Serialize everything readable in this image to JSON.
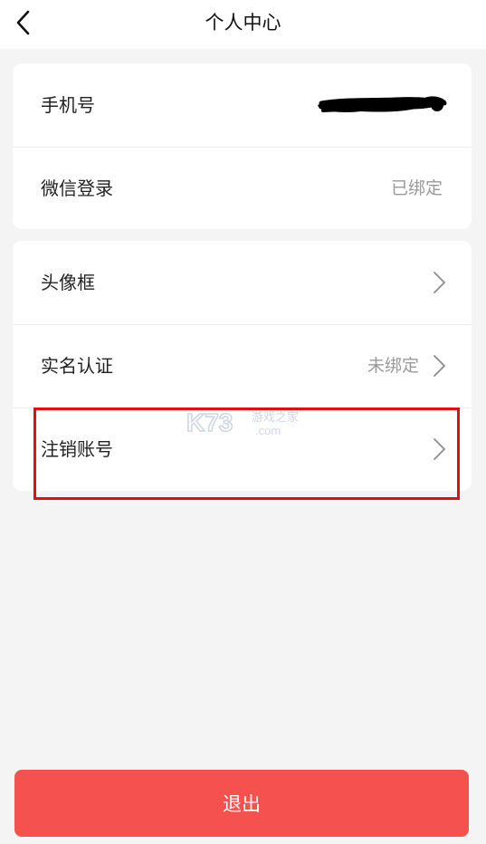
{
  "header": {
    "title": "个人中心",
    "back_icon": "chevron-left-icon"
  },
  "account_card": {
    "phone": {
      "label": "手机号",
      "value_redacted": true
    },
    "wechat": {
      "label": "微信登录",
      "value": "已绑定"
    }
  },
  "settings_card": {
    "avatar_frame": {
      "label": "头像框",
      "icon": "chevron-right-icon"
    },
    "real_name": {
      "label": "实名认证",
      "value": "未绑定",
      "icon": "chevron-right-icon"
    },
    "cancel_account": {
      "label": "注销账号",
      "icon": "chevron-right-icon"
    }
  },
  "watermark": {
    "brand": "K73",
    "tagline": "游戏之家",
    "domain": ".com"
  },
  "annotation": {
    "highlight_color": "#e01010"
  },
  "logout": {
    "label": "退出",
    "color": "#f5524f"
  }
}
